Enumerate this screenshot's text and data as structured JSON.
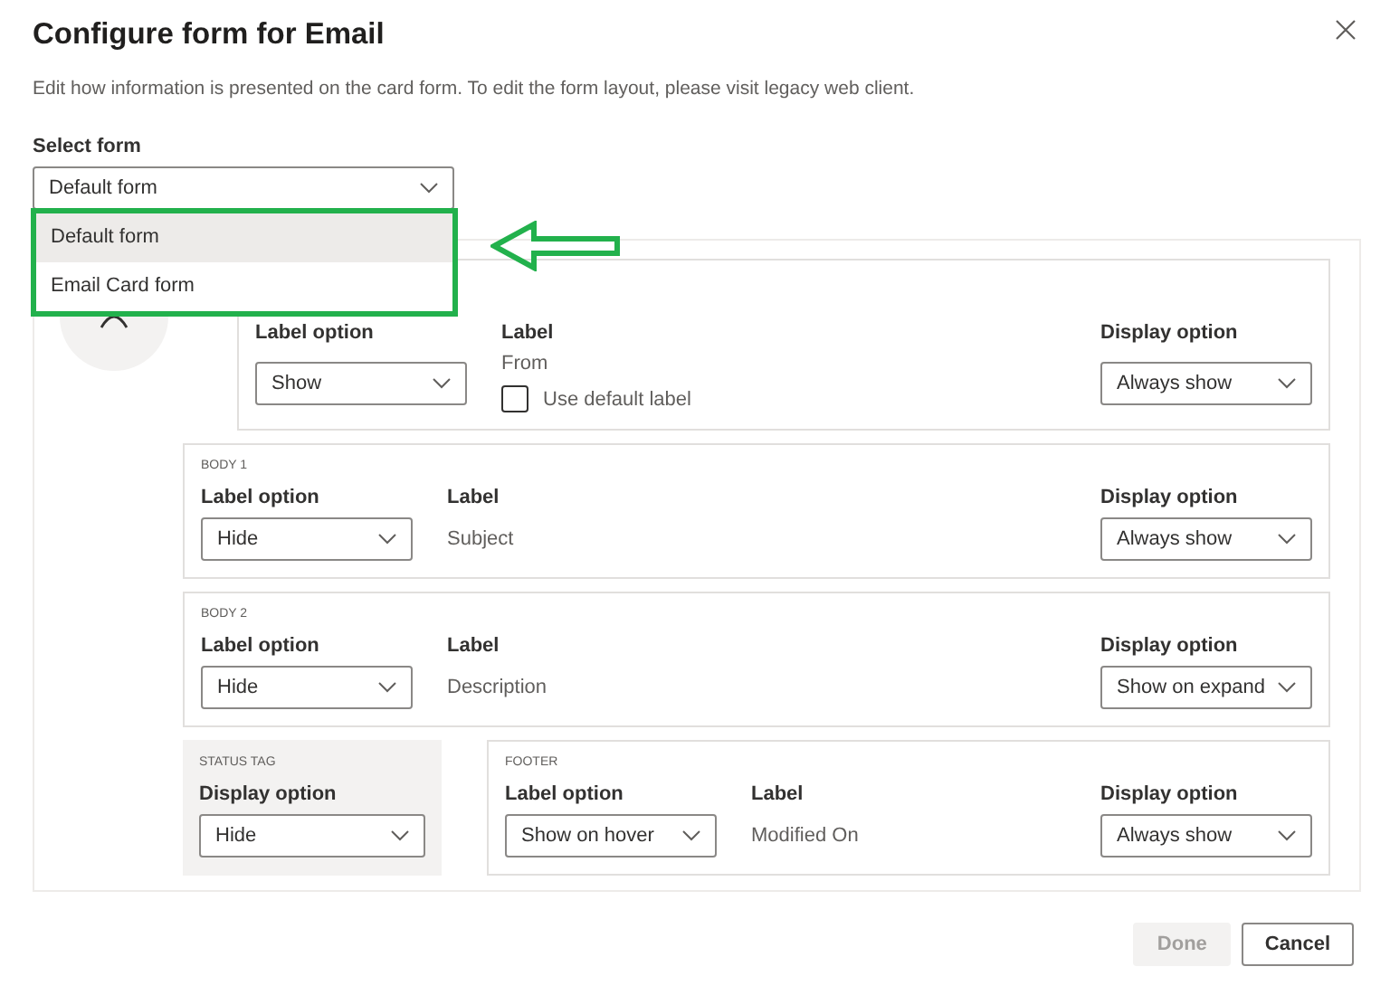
{
  "dialog": {
    "title": "Configure form for Email",
    "description": "Edit how information is presented on the card form. To edit the form layout, please visit legacy web client."
  },
  "select_form": {
    "label": "Select form",
    "value": "Default form",
    "expanded": true,
    "options": [
      {
        "label": "Default form",
        "selected": true
      },
      {
        "label": "Email Card form",
        "selected": false
      }
    ]
  },
  "header": {
    "label_option": {
      "label": "Label option",
      "value": "Show"
    },
    "label": {
      "label": "Label",
      "value": "From"
    },
    "use_default_label": {
      "label": "Use default label",
      "checked": false
    },
    "display_option": {
      "label": "Display option",
      "value": "Always show"
    }
  },
  "body_sections": [
    {
      "title": "BODY 1",
      "label_option": {
        "label": "Label option",
        "value": "Hide"
      },
      "label": {
        "label": "Label",
        "value": "Subject"
      },
      "display_option": {
        "label": "Display option",
        "value": "Always show"
      }
    },
    {
      "title": "BODY 2",
      "label_option": {
        "label": "Label option",
        "value": "Hide"
      },
      "label": {
        "label": "Label",
        "value": "Description"
      },
      "display_option": {
        "label": "Display option",
        "value": "Show on expand"
      }
    }
  ],
  "status_tag": {
    "title": "STATUS TAG",
    "display_option": {
      "label": "Display option",
      "value": "Hide"
    }
  },
  "footer": {
    "title": "FOOTER",
    "label_option": {
      "label": "Label option",
      "value": "Show on hover"
    },
    "label": {
      "label": "Label",
      "value": "Modified On"
    },
    "display_option": {
      "label": "Display option",
      "value": "Always show"
    }
  },
  "buttons": [
    {
      "label": "Done",
      "disabled": true
    },
    {
      "label": "Cancel",
      "disabled": false
    }
  ]
}
